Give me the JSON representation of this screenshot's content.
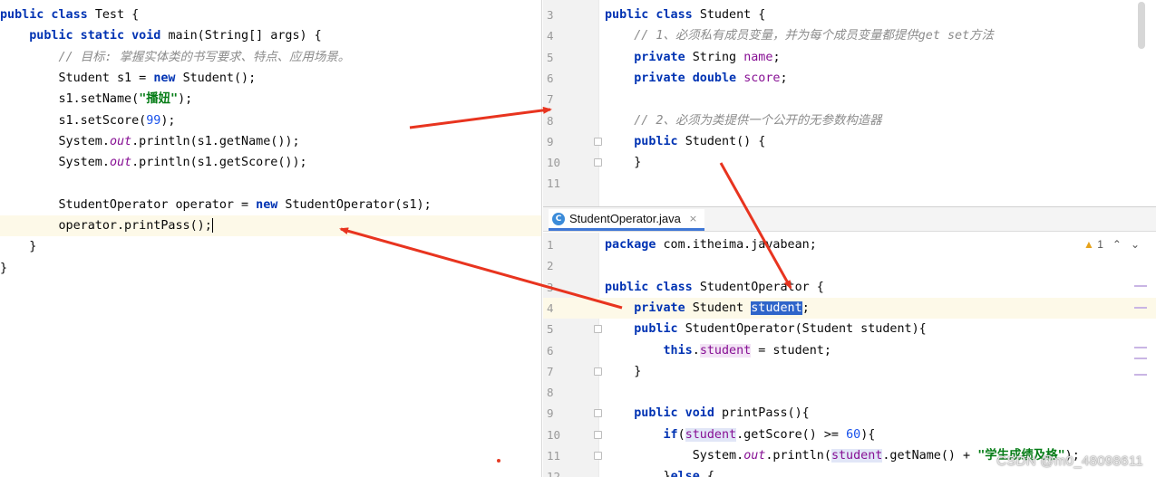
{
  "left_editor": {
    "lines": [
      [
        {
          "t": "public class ",
          "c": "kw"
        },
        {
          "t": "Test {"
        }
      ],
      [
        {
          "t": "    "
        },
        {
          "t": "public static void ",
          "c": "kw"
        },
        {
          "t": "main(String[] args) {"
        }
      ],
      [
        {
          "t": "        "
        },
        {
          "t": "// 目标: 掌握实体类的书写要求、特点、应用场景。",
          "c": "cm"
        }
      ],
      [
        {
          "t": "        Student s1 = "
        },
        {
          "t": "new ",
          "c": "kw"
        },
        {
          "t": "Student();"
        }
      ],
      [
        {
          "t": "        s1.setName("
        },
        {
          "t": "\"播妞\"",
          "c": "st"
        },
        {
          "t": ");"
        }
      ],
      [
        {
          "t": "        s1.setScore("
        },
        {
          "t": "99",
          "c": "num"
        },
        {
          "t": ");"
        }
      ],
      [
        {
          "t": "        System."
        },
        {
          "t": "out",
          "c": "ital"
        },
        {
          "t": ".println(s1.getName());"
        }
      ],
      [
        {
          "t": "        System."
        },
        {
          "t": "out",
          "c": "ital"
        },
        {
          "t": ".println(s1.getScore());"
        }
      ],
      [
        {
          "t": ""
        }
      ],
      [
        {
          "t": "        StudentOperator operator = "
        },
        {
          "t": "new ",
          "c": "kw"
        },
        {
          "t": "StudentOperator(s1);"
        }
      ],
      [
        {
          "t": "        operator.printPass();"
        },
        {
          "t": "",
          "c": "caret"
        }
      ],
      [
        {
          "t": "    }"
        }
      ],
      [
        {
          "t": "}"
        }
      ]
    ]
  },
  "top_editor": {
    "lines": [
      {
        "n": "3",
        "parts": [
          {
            "t": "public class ",
            "c": "kw"
          },
          {
            "t": "Student {"
          }
        ]
      },
      {
        "n": "4",
        "parts": [
          {
            "t": "    "
          },
          {
            "t": "// 1、必须私有成员变量，并为每个成员变量都提供get set方法",
            "c": "cm"
          }
        ]
      },
      {
        "n": "5",
        "parts": [
          {
            "t": "    "
          },
          {
            "t": "private ",
            "c": "kw"
          },
          {
            "t": "String "
          },
          {
            "t": "name",
            "c": "fld"
          },
          {
            "t": ";"
          }
        ]
      },
      {
        "n": "6",
        "parts": [
          {
            "t": "    "
          },
          {
            "t": "private double ",
            "c": "kw"
          },
          {
            "t": "score",
            "c": "fld"
          },
          {
            "t": ";"
          }
        ]
      },
      {
        "n": "7",
        "parts": [
          {
            "t": ""
          }
        ]
      },
      {
        "n": "8",
        "parts": [
          {
            "t": "    "
          },
          {
            "t": "// 2、必须为类提供一个公开的无参数构造器",
            "c": "cm"
          }
        ]
      },
      {
        "n": "9",
        "parts": [
          {
            "t": "    "
          },
          {
            "t": "public ",
            "c": "kw"
          },
          {
            "t": "Student() {"
          }
        ]
      },
      {
        "n": "10",
        "parts": [
          {
            "t": "    }"
          }
        ]
      },
      {
        "n": "11",
        "parts": [
          {
            "t": ""
          }
        ]
      }
    ]
  },
  "bottom_editor": {
    "tab": {
      "label": "StudentOperator.java",
      "icon": "C",
      "close": "×"
    },
    "inspections": {
      "warning_count": "1",
      "up": "⌃",
      "down": "⌄"
    },
    "lines": [
      {
        "n": "1",
        "parts": [
          {
            "t": "package ",
            "c": "kw"
          },
          {
            "t": "com.itheima.javabean;"
          }
        ]
      },
      {
        "n": "2",
        "parts": [
          {
            "t": ""
          }
        ]
      },
      {
        "n": "3",
        "parts": [
          {
            "t": "public class ",
            "c": "kw"
          },
          {
            "t": "StudentOperator {"
          }
        ]
      },
      {
        "n": "4",
        "parts": [
          {
            "t": "    "
          },
          {
            "t": "private ",
            "c": "kw"
          },
          {
            "t": "Student "
          },
          {
            "t": "student",
            "c": "sel"
          },
          {
            "t": ";"
          }
        ]
      },
      {
        "n": "5",
        "parts": [
          {
            "t": "    "
          },
          {
            "t": "public ",
            "c": "kw"
          },
          {
            "t": "StudentOperator(Student student){"
          }
        ]
      },
      {
        "n": "6",
        "parts": [
          {
            "t": "        "
          },
          {
            "t": "this",
            "c": "kw"
          },
          {
            "t": "."
          },
          {
            "t": "student",
            "c": "fld pink"
          },
          {
            "t": " = student;"
          }
        ]
      },
      {
        "n": "7",
        "parts": [
          {
            "t": "    }"
          }
        ]
      },
      {
        "n": "8",
        "parts": [
          {
            "t": ""
          }
        ]
      },
      {
        "n": "9",
        "parts": [
          {
            "t": "    "
          },
          {
            "t": "public void ",
            "c": "kw"
          },
          {
            "t": "printPass(){"
          }
        ]
      },
      {
        "n": "10",
        "parts": [
          {
            "t": "        "
          },
          {
            "t": "if",
            "c": "kw"
          },
          {
            "t": "("
          },
          {
            "t": "student",
            "c": "fld blue"
          },
          {
            "t": ".getScore() >= "
          },
          {
            "t": "60",
            "c": "num"
          },
          {
            "t": "){"
          }
        ]
      },
      {
        "n": "11",
        "parts": [
          {
            "t": "            System."
          },
          {
            "t": "out",
            "c": "ital"
          },
          {
            "t": ".println("
          },
          {
            "t": "student",
            "c": "fld blue"
          },
          {
            "t": ".getName() + "
          },
          {
            "t": "\"学生成绩及格\"",
            "c": "st"
          },
          {
            "t": ");"
          }
        ]
      },
      {
        "n": "12",
        "parts": [
          {
            "t": "        }"
          },
          {
            "t": "else ",
            "c": "kw"
          },
          {
            "t": "{"
          }
        ]
      }
    ]
  },
  "watermark": "CSDN @m0_48098611",
  "colors": {
    "arrow": "#e8341f",
    "keyword": "#0033b3",
    "comment": "#8c8c8c",
    "string": "#067d17",
    "number": "#1750eb",
    "field": "#871094",
    "selection": "#2f65ca"
  }
}
